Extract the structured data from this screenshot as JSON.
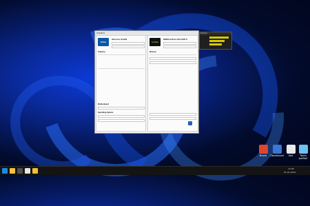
{
  "window": {
    "title": "HWiNFO",
    "cpu_logo": "intel",
    "gpu_logo": "nvidia",
    "cpu_name": "Intel Core i3-9100",
    "gpu_name": "NVIDIA GeForce GTX 1050 Ti",
    "section_cpu": "Features",
    "section_gpu": "Memory",
    "mb_label": "Motherboard",
    "os_label": "Operating System",
    "close_label": "Close"
  },
  "sensor_window": {
    "title": "Sensors"
  },
  "desktop_icons": [
    {
      "label": "Brave",
      "color": "#e0452f"
    },
    {
      "label": "Obsluhovat",
      "color": "#3a76d6"
    },
    {
      "label": "Koš",
      "color": "#e9e9e9"
    },
    {
      "label": "Tento počítač",
      "color": "#6ec1f0"
    }
  ],
  "taskbar": {
    "clock": "12:00",
    "date": "01.01.2024",
    "icon_colors": [
      "#1e88e5",
      "#f6c343",
      "#4f4f4f",
      "#e5e5e5",
      "#f0c030"
    ]
  }
}
